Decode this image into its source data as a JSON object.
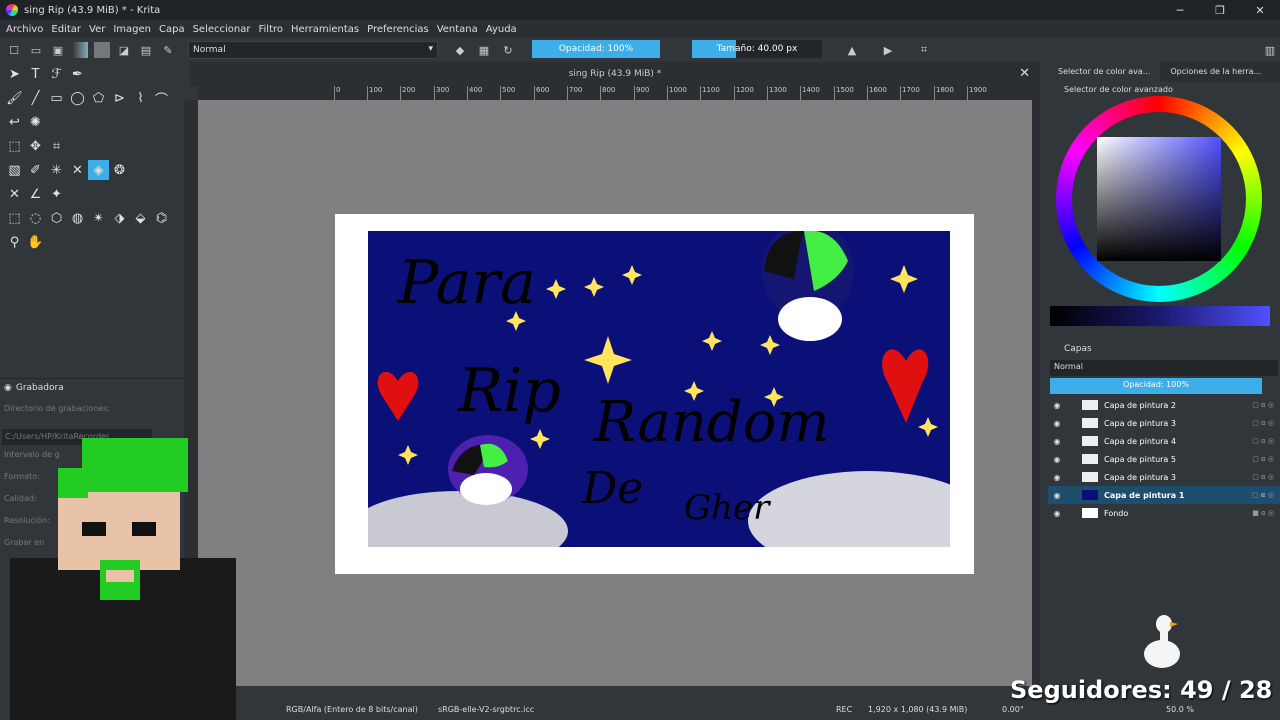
{
  "window": {
    "title": "sing Rip (43.9 MiB) * - Krita",
    "min": "─",
    "max": "❐",
    "close": "✕"
  },
  "menu": [
    "Archivo",
    "Editar",
    "Ver",
    "Imagen",
    "Capa",
    "Seleccionar",
    "Filtro",
    "Herramientas",
    "Preferencias",
    "Ventana",
    "Ayuda"
  ],
  "toolbar": {
    "blend_mode": "Normal",
    "opacity": "Opacidad: 100%",
    "size": "Tamaño: 40.00 px"
  },
  "canvas": {
    "tab_title": "sing Rip (43.9 MiB) *",
    "ruler_labels": [
      "0",
      "100",
      "200",
      "300",
      "400",
      "500",
      "600",
      "700",
      "800",
      "900",
      "1000",
      "1100",
      "1200",
      "1300",
      "1400",
      "1500",
      "1600",
      "1700",
      "1800",
      "1900"
    ],
    "artwork_text": [
      "Para",
      "Rip",
      "Random",
      "De",
      "Gher"
    ]
  },
  "recorder": {
    "title": "Grabadora",
    "dir_label": "Directorio de grabaciones:",
    "path": "C:/Users/HP/KritaRecorder",
    "rows": [
      "Intervalo de g",
      "Formato:",
      "Calidad:",
      "Resolución:",
      "Grabar en"
    ]
  },
  "right": {
    "tabs": [
      "Selector de color ava...",
      "Opciones de la herra..."
    ],
    "color_title": "Selector de color avanzado",
    "layers_title": "Capas",
    "layers_blend": "Normal",
    "layers_opacity": "Opacidad: 100%",
    "layers": [
      {
        "name": "Capa de pintura 2",
        "selected": false
      },
      {
        "name": "Capa de pintura 3",
        "selected": false
      },
      {
        "name": "Capa de pintura 4",
        "selected": false
      },
      {
        "name": "Capa de pintura 5",
        "selected": false
      },
      {
        "name": "Capa de pintura 3",
        "selected": false
      },
      {
        "name": "Capa de pintura 1",
        "selected": true
      },
      {
        "name": "Fondo",
        "selected": false
      }
    ]
  },
  "status": {
    "color_space": "RGB/Alfa (Entero de 8 bits/canal)",
    "profile": "sRGB-elle-V2-srgbtrc.icc",
    "rec": "REC",
    "image_size": "1,920 x 1,080 (43.9 MiB)",
    "rotation": "0.00°",
    "zoom": "50.0 %"
  },
  "overlay": {
    "followers": "Seguidores: 49 / 28"
  }
}
